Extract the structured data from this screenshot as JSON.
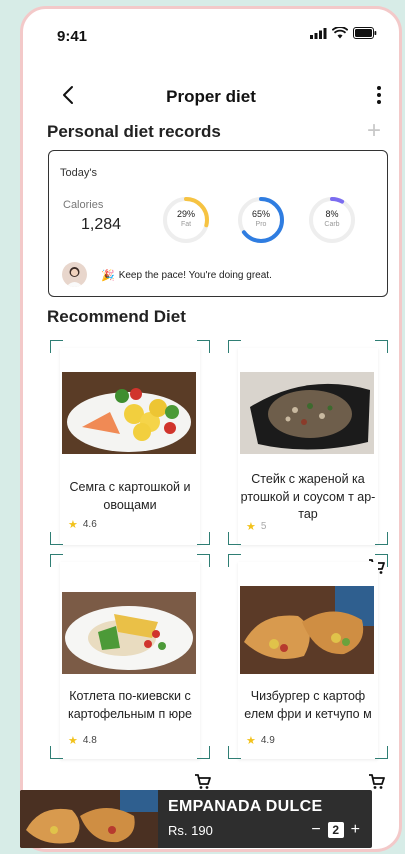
{
  "status": {
    "time": "9:41"
  },
  "header": {
    "title": "Proper diet"
  },
  "records": {
    "section_title": "Personal diet records",
    "today_label": "Today's",
    "calories_label": "Calories",
    "calories_value": "1,284",
    "fat": {
      "pct": "29%",
      "label": "Fat",
      "value": 0.29,
      "color": "#f6c342"
    },
    "pro": {
      "pct": "65%",
      "label": "Pro",
      "value": 0.65,
      "color": "#2f7de1"
    },
    "carb": {
      "pct": "8%",
      "label": "Carb",
      "value": 0.08,
      "color": "#7b6cf0"
    },
    "message": "Keep the pace! You're doing great."
  },
  "recommend": {
    "section_title": "Recommend Diet",
    "items": [
      {
        "name": "Семга с картошкой и овощами",
        "rating": "4.6"
      },
      {
        "name": "Стейк с жареной ка ртошкой и соусом т ар-тар",
        "rating": "5"
      },
      {
        "name": "Котлета по-киевски с картофельным п юре",
        "rating": "4.8"
      },
      {
        "name": "Чизбургер с картоф елем фри и кетчупо м",
        "rating": "4.9"
      }
    ]
  },
  "cart": {
    "item_name": "EMPANADA DULCE",
    "price": "Rs. 190",
    "minus": "−",
    "quantity": "2",
    "plus": "+"
  },
  "colors": {
    "accent": "#2f7e74",
    "background": "#d7ece7",
    "border": "#f3c9c9"
  }
}
